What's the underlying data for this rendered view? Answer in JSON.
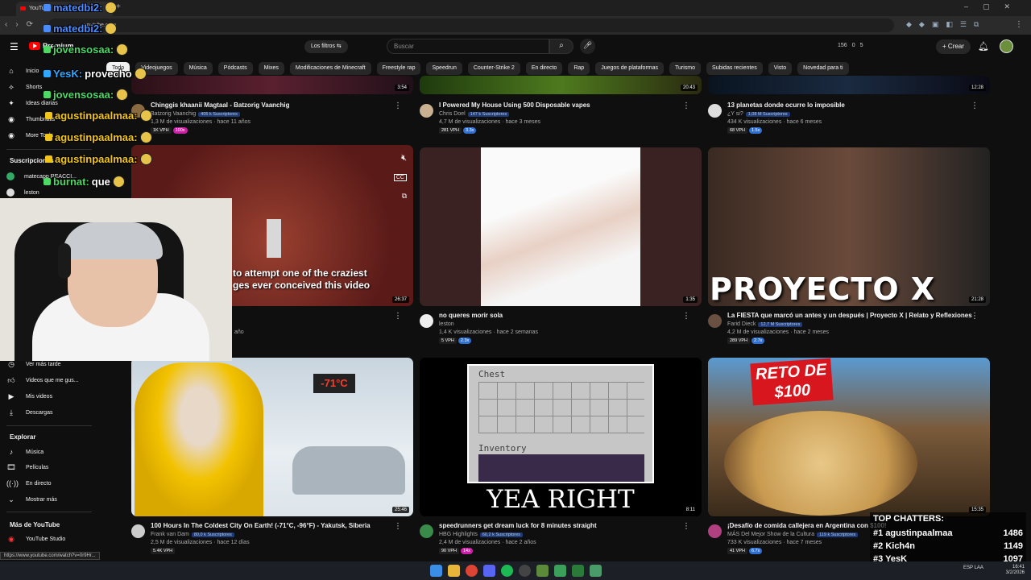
{
  "browser": {
    "tab_title": "YouTube",
    "url": "youtube.com",
    "status_url": "https://www.youtube.com/watch?v=0r9Hr..."
  },
  "topbar": {
    "logo": "Premium",
    "filters": "Los filtros",
    "search_placeholder": "Buscar",
    "stats": [
      "156",
      "0",
      "5"
    ],
    "create": "Crear"
  },
  "chips": [
    "Todo",
    "Videojuegos",
    "Música",
    "Pódcasts",
    "Mixes",
    "Modificaciones de Minecraft",
    "Freestyle rap",
    "Speedrun",
    "Counter-Strike 2",
    "En directo",
    "Rap",
    "Juegos de plataformas",
    "Turismo",
    "Subidas recientes",
    "Visto",
    "Novedad para ti"
  ],
  "sidebar": {
    "main": [
      {
        "label": "Inicio",
        "icon": "home-icon"
      },
      {
        "label": "Shorts",
        "icon": "shorts-icon"
      },
      {
        "label": "Ideas diarias",
        "icon": "idea-icon"
      },
      {
        "label": "Thumbnails",
        "icon": "thumbnail-icon"
      },
      {
        "label": "More Tools",
        "icon": "tools-icon"
      }
    ],
    "subs_head": "Suscripciones",
    "subs": [
      "matecapp REACCI...",
      "leston"
    ],
    "you": [
      {
        "label": "Ver más tarde",
        "icon": "clock-icon"
      },
      {
        "label": "Videos que me gus...",
        "icon": "like-icon"
      },
      {
        "label": "Mis videos",
        "icon": "video-icon"
      },
      {
        "label": "Descargas",
        "icon": "download-icon"
      }
    ],
    "explore_head": "Explorar",
    "explore": [
      {
        "label": "Música",
        "icon": "music-icon"
      },
      {
        "label": "Películas",
        "icon": "film-icon"
      },
      {
        "label": "En directo",
        "icon": "live-icon"
      },
      {
        "label": "Mostrar más",
        "icon": "chevron-down-icon"
      }
    ],
    "more_head": "Más de YouTube",
    "more": [
      {
        "label": "YouTube Studio",
        "icon": "studio-icon"
      }
    ]
  },
  "videos_row1": [
    {
      "title": "Chinggis khaanii Magtaal - Batzorig Vaanchig",
      "channel": "Batzorig Vaanchig",
      "subs": "405 k Suscriptores",
      "meta": "1,3 M de visualizaciones · hace 11 años",
      "vph": "1K VPH",
      "ratio": "100x",
      "duration": "3:54"
    },
    {
      "title": "I Powered My House Using 500 Disposable vapes",
      "channel": "Chris Doel",
      "subs": "147 k Suscriptores",
      "meta": "4,7 M de visualizaciones · hace 3 meses",
      "vph": "281 VPH",
      "ratio": "3.3x",
      "duration": "20:43"
    },
    {
      "title": "13 planetas donde ocurre lo imposible",
      "channel": "¿Y si?",
      "subs": "1,08 M Suscriptores",
      "meta": "434 K visualizaciones · hace 6 meses",
      "vph": "68 VPH",
      "ratio": "1.5x",
      "duration": "12:28"
    }
  ],
  "videos_row2": [
    {
      "title": "",
      "channel": "",
      "subs": "",
      "meta": "año",
      "vph": "",
      "ratio": "",
      "duration": "26:37",
      "overlay": "to attempt one of the craziest ges ever conceived this video"
    },
    {
      "title": "no queres morir sola",
      "channel": "leston",
      "subs": "",
      "meta": "1,4 K visualizaciones · hace 2 semanas",
      "vph": "5 VPH",
      "ratio": "2.3x",
      "duration": "1:35"
    },
    {
      "title": "La FIESTA que marcó un antes y un después | Proyecto X | Relato y Reflexiones",
      "channel": "Farid Dieck",
      "subs": "12,7 M Suscriptores",
      "meta": "4,2 M de visualizaciones · hace 2 meses",
      "vph": "289 VPH",
      "ratio": "2.7x",
      "duration": "21:28",
      "overlay": "PROYECTO X"
    }
  ],
  "videos_row3": [
    {
      "title": "100 Hours In The Coldest City On Earth! (-71°C, -96°F) - Yakutsk, Siberia",
      "channel": "Frank van Dam",
      "subs": "80,0 k Suscriptores",
      "meta": "2,5 M de visualizaciones · hace 12 días",
      "vph": "5.4K VPH",
      "ratio": "",
      "duration": "25:46",
      "overlay": "-71°C"
    },
    {
      "title": "speedrunners get dream luck for 8 minutes straight",
      "channel": "HBG Highlights",
      "subs": "60,2 k Suscriptores",
      "meta": "2,4 M de visualizaciones · hace 2 años",
      "vph": "90 VPH",
      "ratio": "14x",
      "duration": "8:11",
      "overlay": "YEA RIGHT",
      "chest": "Chest",
      "inventory": "Inventory"
    },
    {
      "title": "¡Desafío de comida callejera en Argentina con $100!",
      "channel": "MÁS Del Mejor Show de la Cultura",
      "subs": "119 k Suscriptores",
      "meta": "733 K visualizaciones · hace 7 meses",
      "vph": "41 VPH",
      "ratio": "6.7x",
      "duration": "15:35",
      "overlay": "RETO DE $100"
    }
  ],
  "chat": [
    {
      "user": "matedbi2:",
      "color": "#4a8cff"
    },
    {
      "user": "matedbi2:",
      "color": "#4a8cff"
    },
    {
      "user": "jovensosaa:",
      "color": "#4cd964"
    },
    {
      "user": "YesK:",
      "text": "provecho",
      "color": "#2fa7ff"
    },
    {
      "user": "jovensosaa:",
      "color": "#4cd964"
    },
    {
      "user": "agustinpaalmaa:",
      "color": "#f0c419"
    },
    {
      "user": "agustinpaalmaa:",
      "color": "#f0c419"
    },
    {
      "user": "agustinpaalmaa:",
      "color": "#f0c419"
    },
    {
      "user": "burnat:",
      "text": "que",
      "color": "#4cd964"
    }
  ],
  "top_chatters": {
    "title": "TOP CHATTERS:",
    "rows": [
      {
        "rank": "#1",
        "name": "agustinpaalmaa",
        "count": "1486"
      },
      {
        "rank": "#2",
        "name": "Kich4n",
        "count": "1149"
      },
      {
        "rank": "#3",
        "name": "YesK",
        "count": "1097"
      }
    ]
  },
  "taskbar": {
    "lang": "ESP LAA",
    "time": "16:41",
    "date": "3/2/2026"
  }
}
